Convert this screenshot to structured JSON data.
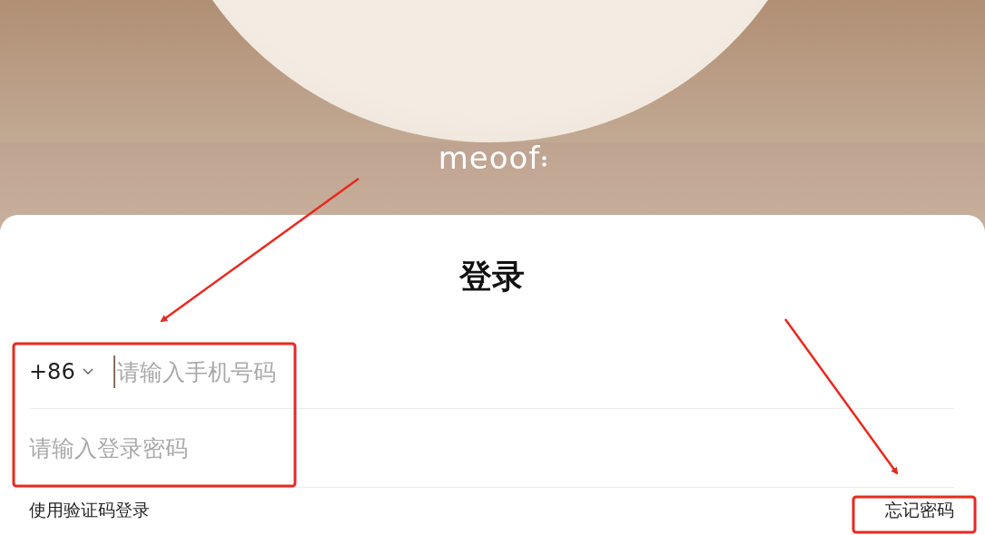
{
  "header": {
    "logo": "meoof"
  },
  "login": {
    "title": "登录",
    "phone": {
      "country_code": "+86",
      "placeholder": "请输入手机号码",
      "focused": true
    },
    "password": {
      "placeholder": "请输入登录密码"
    },
    "sms_login_link": "使用验证码登录",
    "forgot_password_link": "忘记密码"
  }
}
